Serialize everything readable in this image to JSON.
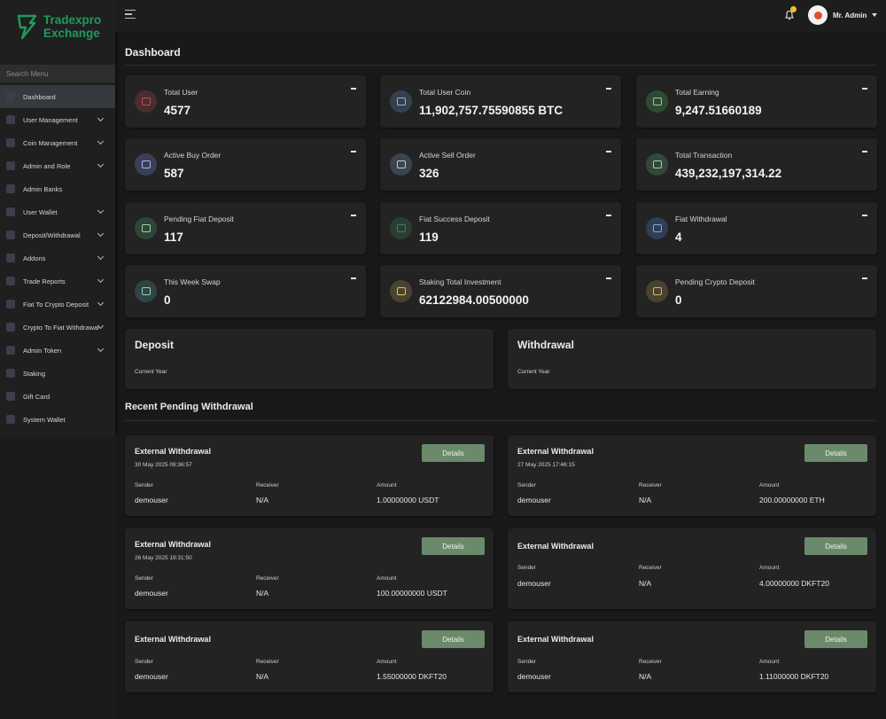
{
  "brand": {
    "line1": "Tradexpro",
    "line2": "Exchange",
    "color": "#1f9b5b"
  },
  "sidebar": {
    "search_placeholder": "Search Menu",
    "items": [
      {
        "label": "Dashboard",
        "icon": "dashboard-icon",
        "active": true,
        "has_children": false
      },
      {
        "label": "User Management",
        "icon": "users-icon",
        "has_children": true
      },
      {
        "label": "Coin Management",
        "icon": "coin-icon",
        "has_children": true
      },
      {
        "label": "Admin and Role",
        "icon": "admin-icon",
        "has_children": true
      },
      {
        "label": "Admin Banks",
        "icon": "bank-icon",
        "has_children": false
      },
      {
        "label": "User Wallet",
        "icon": "wallet-icon",
        "has_children": true
      },
      {
        "label": "Deposit/Withdrawal",
        "icon": "deposit-icon",
        "has_children": true
      },
      {
        "label": "Addons",
        "icon": "addons-icon",
        "has_children": true
      },
      {
        "label": "Trade Reports",
        "icon": "chart-icon",
        "has_children": true
      },
      {
        "label": "Fiat To Crypto Deposit",
        "icon": "dollar-icon",
        "has_children": true
      },
      {
        "label": "Crypto To Fiat Withdrawal",
        "icon": "exchange-icon",
        "has_children": true
      },
      {
        "label": "Admin Token",
        "icon": "token-icon",
        "has_children": true
      },
      {
        "label": "Staking",
        "icon": "staking-icon",
        "has_children": false
      },
      {
        "label": "Gift Card",
        "icon": "gift-icon",
        "has_children": false
      },
      {
        "label": "System Wallet",
        "icon": "system-wallet-icon",
        "has_children": false
      }
    ]
  },
  "header": {
    "user_name": "Mr. Admin",
    "notification_dot_color": "#f2c21b"
  },
  "page_title": "Dashboard",
  "stats": [
    {
      "label": "Total User",
      "value": "4577",
      "icon": "users-icon",
      "color": "#c0504d",
      "bg": "#4a2d2d"
    },
    {
      "label": "Total User Coin",
      "value": "11,902,757.75590855 BTC",
      "icon": "coin-stack-icon",
      "color": "#8fb3d9",
      "bg": "#34404e"
    },
    {
      "label": "Total Earning",
      "value": "9,247.51660189",
      "icon": "money-icon",
      "color": "#8fd18f",
      "bg": "#2f4a33"
    },
    {
      "label": "Active Buy Order",
      "value": "587",
      "icon": "buy-order-icon",
      "color": "#a9b4ff",
      "bg": "#3a3f56"
    },
    {
      "label": "Active Sell Order",
      "value": "326",
      "icon": "sell-order-icon",
      "color": "#b9c9d9",
      "bg": "#3b4550"
    },
    {
      "label": "Total Transaction",
      "value": "439,232,197,314.22",
      "icon": "transaction-icon",
      "color": "#a4d39a",
      "bg": "#34473a"
    },
    {
      "label": "Pending Fiat Deposit",
      "value": "117",
      "icon": "fiat-pending-icon",
      "color": "#9bd3a3",
      "bg": "#304438"
    },
    {
      "label": "Fiat Success Deposit",
      "value": "119",
      "icon": "fiat-success-icon",
      "color": "#3f7d59",
      "bg": "#2b3d33"
    },
    {
      "label": "Fiat Withdrawal",
      "value": "4",
      "icon": "filter-icon",
      "color": "#7aa7e6",
      "bg": "#2f3d55"
    },
    {
      "label": "This Week Swap",
      "value": "0",
      "icon": "swap-icon",
      "color": "#8fd1c9",
      "bg": "#2f4543"
    },
    {
      "label": "Staking Total Investment",
      "value": "62122984.00500000",
      "icon": "staking-hand-icon",
      "color": "#e3c25a",
      "bg": "#4a4330"
    },
    {
      "label": "Pending Crypto Deposit",
      "value": "0",
      "icon": "crypto-pending-icon",
      "color": "#e0b45a",
      "bg": "#4a4230"
    }
  ],
  "charts": [
    {
      "title": "Deposit",
      "subtitle": "Current Year"
    },
    {
      "title": "Withdrawal",
      "subtitle": "Current Year"
    }
  ],
  "recent_section_title": "Recent Pending Withdrawal",
  "withdrawal_headers": {
    "sender": "Sender",
    "receiver": "Receiver",
    "amount": "Amount"
  },
  "withdrawals": [
    {
      "title": "External Withdrawal",
      "date": "30 May 2025 09:36:57",
      "sender": "demouser",
      "receiver": "N/A",
      "amount": "1.00000000 USDT",
      "button": "Details"
    },
    {
      "title": "External Withdrawal",
      "date": "27 May 2025 17:46:15",
      "sender": "demouser",
      "receiver": "N/A",
      "amount": "200.00000000 ETH",
      "button": "Details"
    },
    {
      "title": "External Withdrawal",
      "date": "26 May 2025 19:31:50",
      "sender": "demouser",
      "receiver": "N/A",
      "amount": "100.00000000 USDT",
      "button": "Details"
    },
    {
      "title": "External Withdrawal",
      "date": "",
      "sender": "demouser",
      "receiver": "N/A",
      "amount": "4.00000000 DKFT20",
      "button": "Details"
    },
    {
      "title": "External Withdrawal",
      "date": "",
      "sender": "demouser",
      "receiver": "N/A",
      "amount": "1.55000000 DKFT20",
      "button": "Details"
    },
    {
      "title": "External Withdrawal",
      "date": "",
      "sender": "demouser",
      "receiver": "N/A",
      "amount": "1.11000000 DKFT20",
      "button": "Details"
    }
  ]
}
